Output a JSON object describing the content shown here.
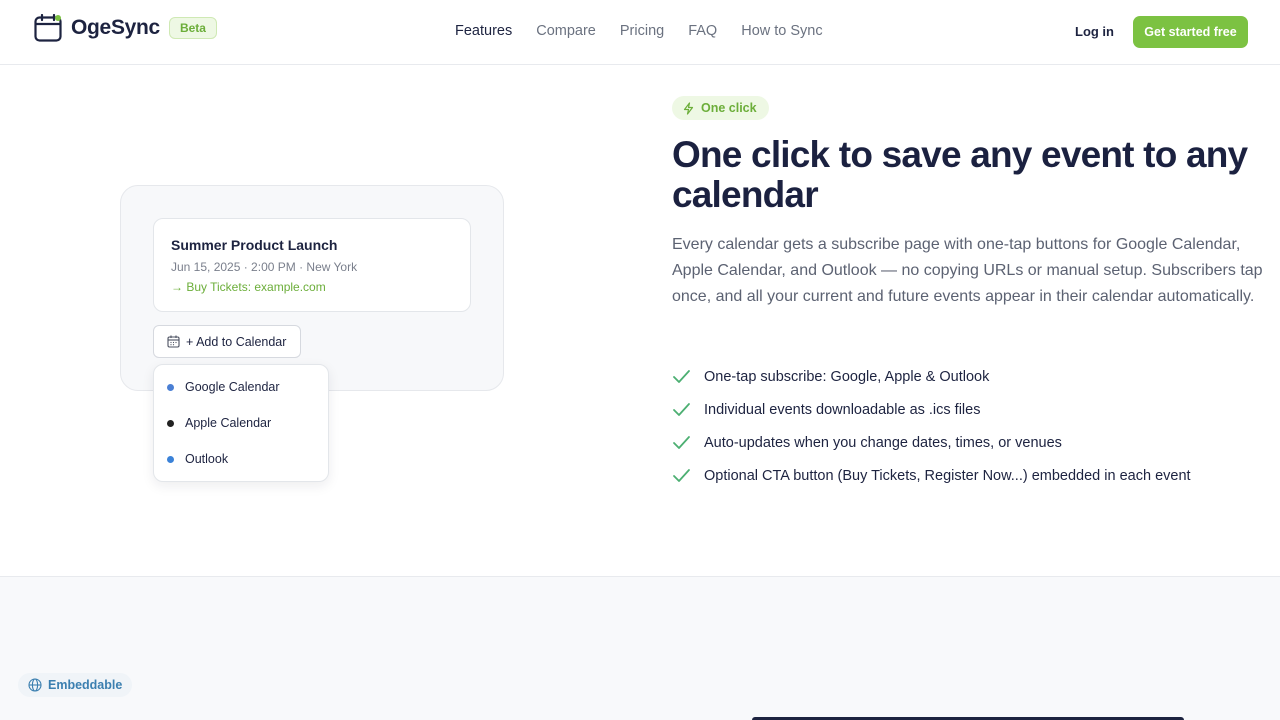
{
  "header": {
    "brand": "OgeSync",
    "badge": "Beta",
    "nav": [
      "Features",
      "Compare",
      "Pricing",
      "FAQ",
      "How to Sync"
    ],
    "login": "Log in",
    "cta": "Get started free"
  },
  "illustration": {
    "event_title": "Summer Product Launch",
    "event_meta": "Jun 15, 2025 · 2:00 PM · New York",
    "event_link": "→ Buy Tickets: example.com",
    "add_button": "+ Add to Calendar",
    "options": [
      {
        "label": "Google Calendar",
        "color": "#4a7fd4"
      },
      {
        "label": "Apple Calendar",
        "color": "#222222"
      },
      {
        "label": "Outlook",
        "color": "#3b82d8"
      }
    ]
  },
  "main": {
    "pill": "One click",
    "headline": "One click to save any event to any calendar",
    "description": "Every calendar gets a subscribe page with one-tap buttons for Google Calendar, Apple Calendar, and Outlook — no copying URLs or manual setup. Subscribers tap once, and all your current and future events appear in their calendar automatically.",
    "features": [
      "One-tap subscribe: Google, Apple & Outlook",
      "Individual events downloadable as .ics files",
      "Auto-updates when you change dates, times, or venues",
      "Optional CTA button (Buy Tickets, Register Now...) embedded in each event"
    ]
  },
  "next_section": {
    "pill": "Embeddable"
  },
  "colors": {
    "accent": "#7cc242",
    "check": "#4caf72",
    "heading": "#1b2140"
  }
}
